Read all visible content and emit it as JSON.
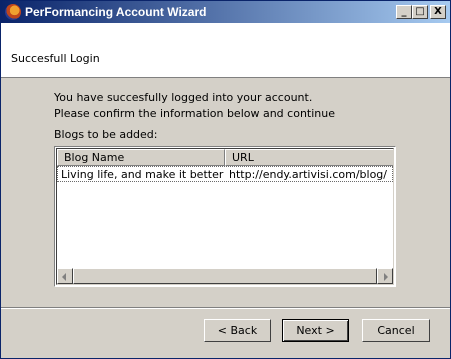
{
  "window": {
    "title": "PerFormancing Account Wizard",
    "minimize_label": "_",
    "maximize_label": "□",
    "close_label": "X"
  },
  "header": {
    "title": "Succesfull Login"
  },
  "content": {
    "line1": "You have succesfully logged into your account.",
    "line2": "Please confirm the information below and continue",
    "list_label": "Blogs to be added:"
  },
  "blog_list": {
    "columns": [
      "Blog Name",
      "URL"
    ],
    "rows": [
      {
        "name": "Living life, and make it better",
        "url": "http://endy.artivisi.com/blog/"
      }
    ]
  },
  "buttons": {
    "back": "< Back",
    "next": "Next >",
    "cancel": "Cancel"
  },
  "colors": {
    "titlebar_start": "#0a246a",
    "titlebar_end": "#a6caf0",
    "face": "#d4d0c8"
  }
}
